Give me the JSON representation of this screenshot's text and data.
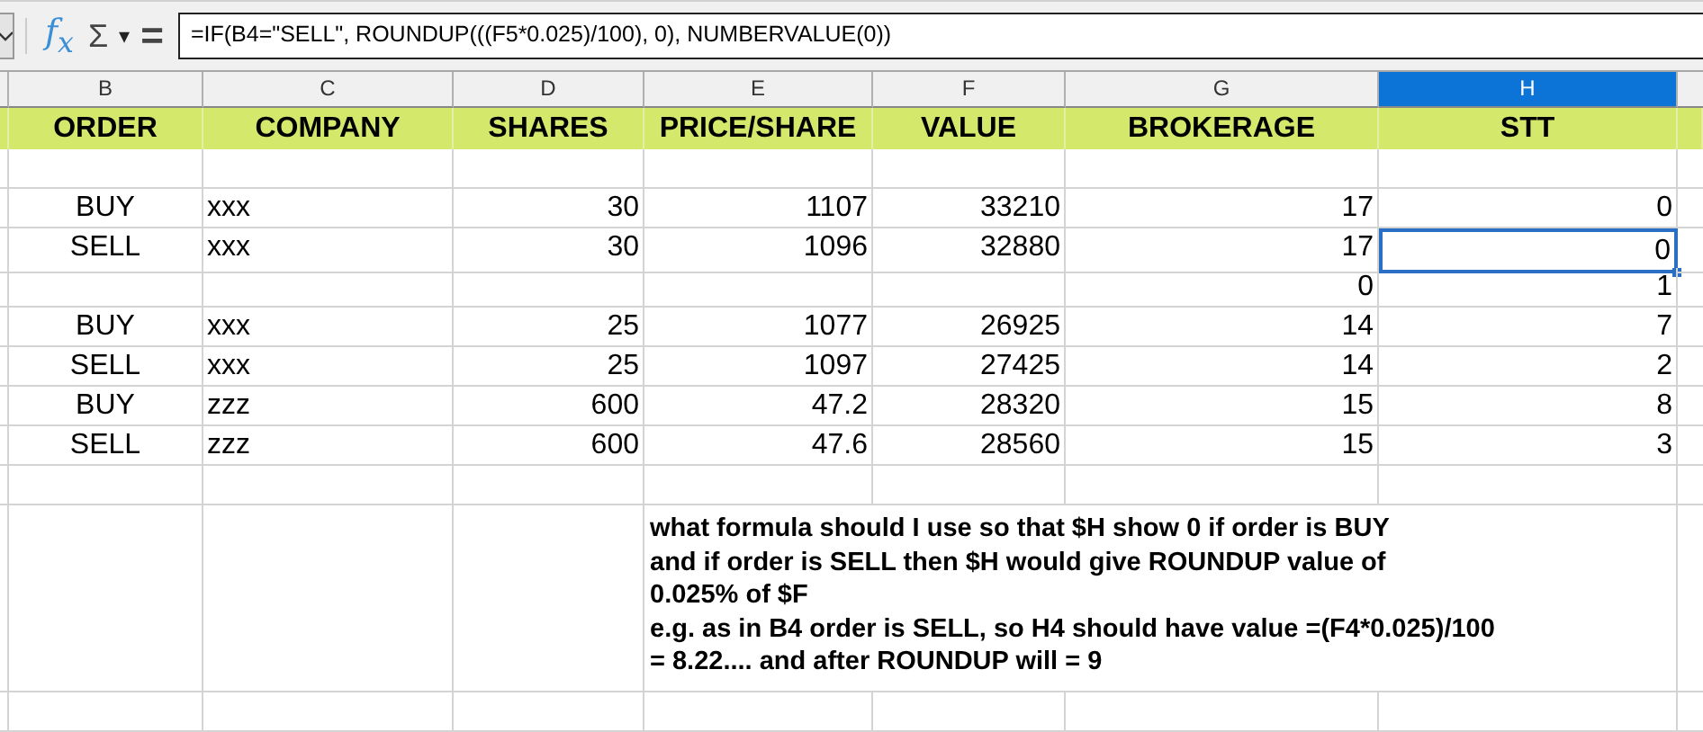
{
  "formula_bar": {
    "function_wizard": "f$_{x}$",
    "sum": "Σ",
    "sum_menu": "▾",
    "equals": "=",
    "formula": "=IF(B4=\"SELL\", ROUNDUP(((F5*0.025)/100), 0), NUMBERVALUE(0))"
  },
  "columns": [
    {
      "letter": "B",
      "title": "ORDER",
      "selected": false
    },
    {
      "letter": "C",
      "title": "COMPANY",
      "selected": false
    },
    {
      "letter": "D",
      "title": "SHARES",
      "selected": false
    },
    {
      "letter": "E",
      "title": "PRICE/SHARE",
      "selected": false
    },
    {
      "letter": "F",
      "title": "VALUE",
      "selected": false
    },
    {
      "letter": "G",
      "title": "BROKERAGE",
      "selected": false
    },
    {
      "letter": "H",
      "title": "STT",
      "selected": true
    }
  ],
  "rows": [
    {
      "cells": [
        "BUY",
        "xxx",
        "30",
        "1107",
        "33210",
        "17",
        "0"
      ],
      "stt_selected": false
    },
    {
      "cells": [
        "SELL",
        "xxx",
        "30",
        "1096",
        "32880",
        "17",
        "0"
      ],
      "stt_selected": true
    },
    {
      "cells": [
        null,
        null,
        null,
        null,
        null,
        "0",
        "1"
      ],
      "stt_selected": false
    },
    {
      "cells": [
        "BUY",
        "xxx",
        "25",
        "1077",
        "26925",
        "14",
        "7"
      ],
      "stt_selected": false
    },
    {
      "cells": [
        "SELL",
        "xxx",
        "25",
        "1097",
        "27425",
        "14",
        "2"
      ],
      "stt_selected": false
    },
    {
      "cells": [
        "BUY",
        "zzz",
        "600",
        "47.2",
        "28320",
        "15",
        "8"
      ],
      "stt_selected": false
    },
    {
      "cells": [
        "SELL",
        "zzz",
        "600",
        "47.6",
        "28560",
        "15",
        "3"
      ],
      "stt_selected": false
    }
  ],
  "note": [
    "what formula should I use so that $H show 0 if order is BUY",
    "and if order is SELL then $H would give ROUNDUP value of",
    "0.025% of $F",
    "e.g. as in B4 order is SELL, so H4 should have value =(F4*0.025)/100",
    "= 8.22.... and after ROUNDUP will = 9"
  ]
}
